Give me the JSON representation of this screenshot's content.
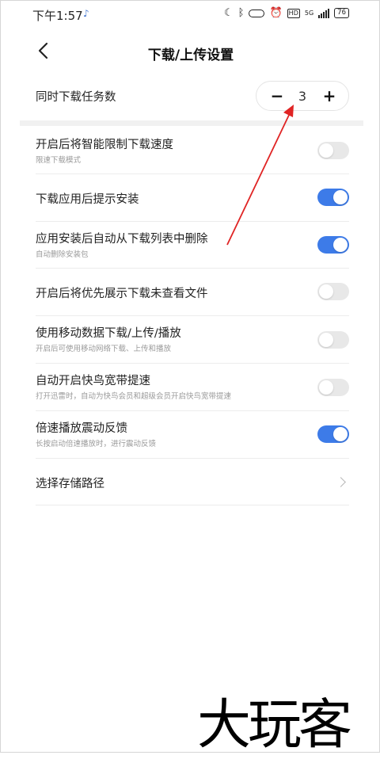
{
  "status": {
    "time": "下午1:57",
    "music_note": "♪",
    "network_label": "5G",
    "battery": "76"
  },
  "header": {
    "title": "下载/上传设置"
  },
  "concurrent": {
    "label": "同时下载任务数",
    "minus": "−",
    "value": "3",
    "plus": "+"
  },
  "settings": [
    {
      "title": "开启后将智能限制下载速度",
      "subtitle": "限速下载模式",
      "on": false
    },
    {
      "title": "下载应用后提示安装",
      "subtitle": "",
      "on": true
    },
    {
      "title": "应用安装后自动从下载列表中删除",
      "subtitle": "自动删除安装包",
      "on": true
    },
    {
      "title": "开启后将优先展示下载未查看文件",
      "subtitle": "",
      "on": false
    },
    {
      "title": "使用移动数据下载/上传/播放",
      "subtitle": "开启后可使用移动网络下载、上传和播放",
      "on": false
    },
    {
      "title": "自动开启快鸟宽带提速",
      "subtitle": "打开迅雷时，自动为快鸟会员和超级会员开启快鸟宽带提速",
      "on": false
    },
    {
      "title": "倍速播放震动反馈",
      "subtitle": "长按启动倍速播放时，进行震动反馈",
      "on": true
    }
  ],
  "storage": {
    "label": "选择存储路径"
  },
  "watermark": "大玩客",
  "colors": {
    "accent": "#3d7be8",
    "annotation": "#e02424"
  },
  "icons": {
    "back": "back-icon",
    "chevron": "chevron-right-icon"
  }
}
